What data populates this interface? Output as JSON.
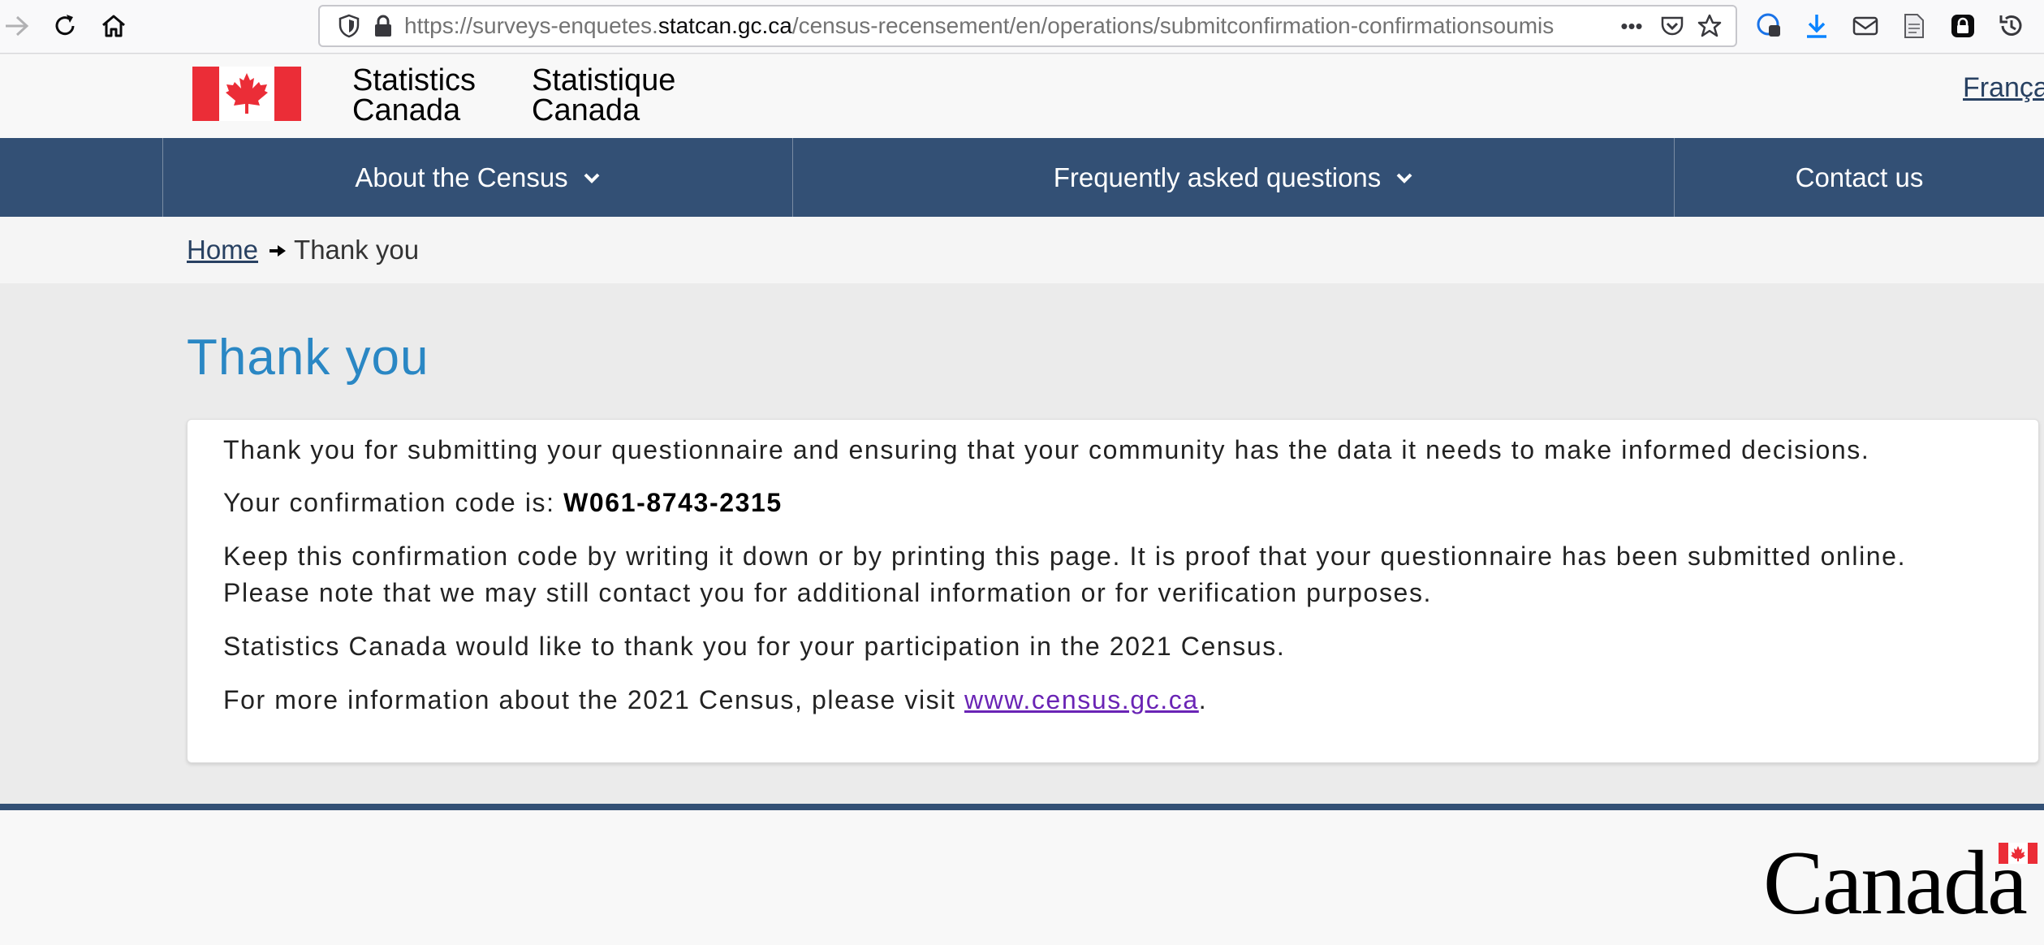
{
  "browser": {
    "url_scheme": "https://surveys-enquetes.",
    "url_domain": "statcan.gc.ca",
    "url_path": "/census-recensement/en/operations/submitconfirmation-confirmationsoumis",
    "more_label": "•••",
    "icons": [
      "back-arrow-icon",
      "reload-icon",
      "home-icon",
      "shield-icon",
      "lock-icon",
      "pocket-icon",
      "star-icon",
      "extension-icon",
      "download-icon",
      "mail-icon",
      "reader-icon",
      "extension-dark-icon",
      "history-icon"
    ]
  },
  "header": {
    "sig_en_line1": "Statistics",
    "sig_en_line2": "Canada",
    "sig_fr_line1": "Statistique",
    "sig_fr_line2": "Canada",
    "language_link": "Français"
  },
  "menu": {
    "items": [
      {
        "label": "About the Census",
        "has_dropdown": true
      },
      {
        "label": "Frequently asked questions",
        "has_dropdown": true
      },
      {
        "label": "Contact us",
        "has_dropdown": false
      }
    ]
  },
  "breadcrumb": {
    "home": "Home",
    "current": "Thank you"
  },
  "main": {
    "title": "Thank you",
    "paragraph1": "Thank you for submitting your questionnaire and ensuring that your community has the data it needs to make informed decisions.",
    "code_label": "Your confirmation code is: ",
    "code_value": "W061-8743-2315",
    "keep_line1": "Keep this confirmation code by writing it down or by printing this page. It is proof that your questionnaire has been submitted online.",
    "keep_line2": "Please note that we may still contact you for additional information or for verification purposes.",
    "thanks_participation": "Statistics Canada would like to thank you for your participation in the 2021 Census.",
    "more_info_prefix": "For more information about the 2021 Census, please visit ",
    "more_info_link": "www.census.gc.ca",
    "more_info_suffix": "."
  },
  "footer": {
    "wordmark": "Canada"
  },
  "colors": {
    "menu_bg": "#335075",
    "title_blue": "#2a87c4",
    "visited_link": "#6a24b5",
    "flag_red": "#eb2d37"
  }
}
